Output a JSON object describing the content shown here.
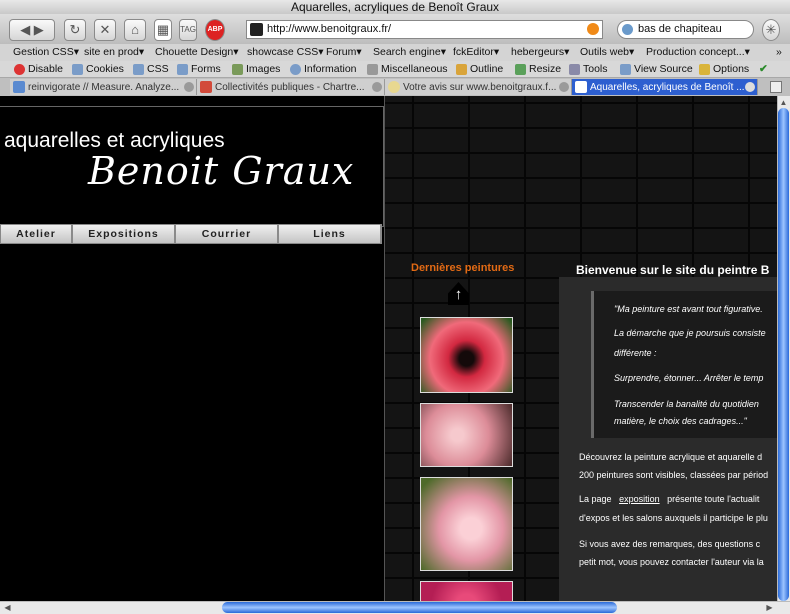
{
  "window": {
    "title": "Aquarelles, acryliques de Benoît Graux"
  },
  "navbar": {
    "back_icon": "back-arrow-icon",
    "url": "http://www.benoitgraux.fr/",
    "search_value": "bas de chapiteau"
  },
  "bookmarks": [
    "Gestion CSS▾",
    "site en prod▾",
    "Chouette Design▾",
    "showcase CSS▾",
    "Forum▾",
    "Search engine▾",
    "fckEditor▾",
    "hebergeurs▾",
    "Outils web▾",
    "Production concept...▾",
    "»"
  ],
  "webdev": [
    "Disable",
    "Cookies",
    "CSS",
    "Forms",
    "Images",
    "Information",
    "Miscellaneous",
    "Outline",
    "Resize",
    "Tools",
    "View Source",
    "Options"
  ],
  "tabs": [
    {
      "label": "reinvigorate // Measure. Analyze..."
    },
    {
      "label": "Collectivités publiques - Chartre..."
    },
    {
      "label": "Votre avis sur www.benoitgraux.f..."
    },
    {
      "label": "Aquarelles, acryliques de Benoît ..."
    }
  ],
  "site": {
    "subtitle": "aquarelles et acryliques",
    "logo": "Benoit Graux",
    "menu": [
      "Atelier",
      "Expositions",
      "Courrier",
      "Liens"
    ],
    "latest_title": "Dernières peintures",
    "welcome_title": "Bienvenue sur le site du peintre B",
    "quote": [
      "\"Ma peinture est avant tout figurative.",
      "La démarche que je poursuis consiste",
      "différente :",
      "Surprendre, étonner... Arrêter le temp",
      "Transcender la banalité du quotidien",
      "matière, le choix des cadrages...\""
    ],
    "paragraphs": [
      "Découvrez la peinture acrylique et aquarelle d",
      "200 peintures sont visibles, classées par périod",
      "présente toute l'actualit",
      "d'expos et les salons auxquels il participe le plu",
      "Si vous avez des remarques, des questions c",
      "petit mot, vous pouvez contacter l'auteur via la"
    ],
    "para3_prefix": "La page",
    "exposition_link": "exposition"
  }
}
